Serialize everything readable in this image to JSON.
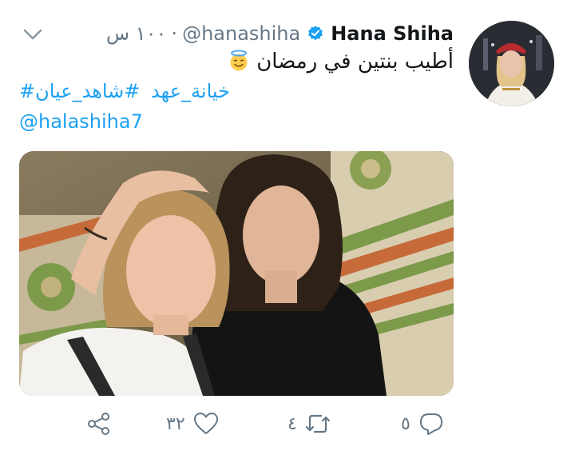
{
  "tweet": {
    "display_name": "Hana Shiha",
    "handle": "@hanashiha",
    "separator": "·",
    "time": "١٠٠ س",
    "text": "أطيب بنتين في رمضان",
    "hashtags": [
      "#خيانة_عهد",
      "#شاهد_عيان"
    ],
    "mention": "@halashiha7",
    "verified": true
  },
  "actions": {
    "reply_count": "٥",
    "retweet_count": "٤",
    "like_count": "٣٢"
  },
  "icons": {
    "menu": "chevron-down-icon",
    "verified": "verified-badge-icon",
    "emoji": "smiling-face-with-halo-icon",
    "reply": "reply-icon",
    "retweet": "retweet-icon",
    "like": "heart-icon",
    "share": "share-icon"
  },
  "colors": {
    "link": "#1da1f2",
    "muted": "#657786",
    "text": "#14171a"
  }
}
